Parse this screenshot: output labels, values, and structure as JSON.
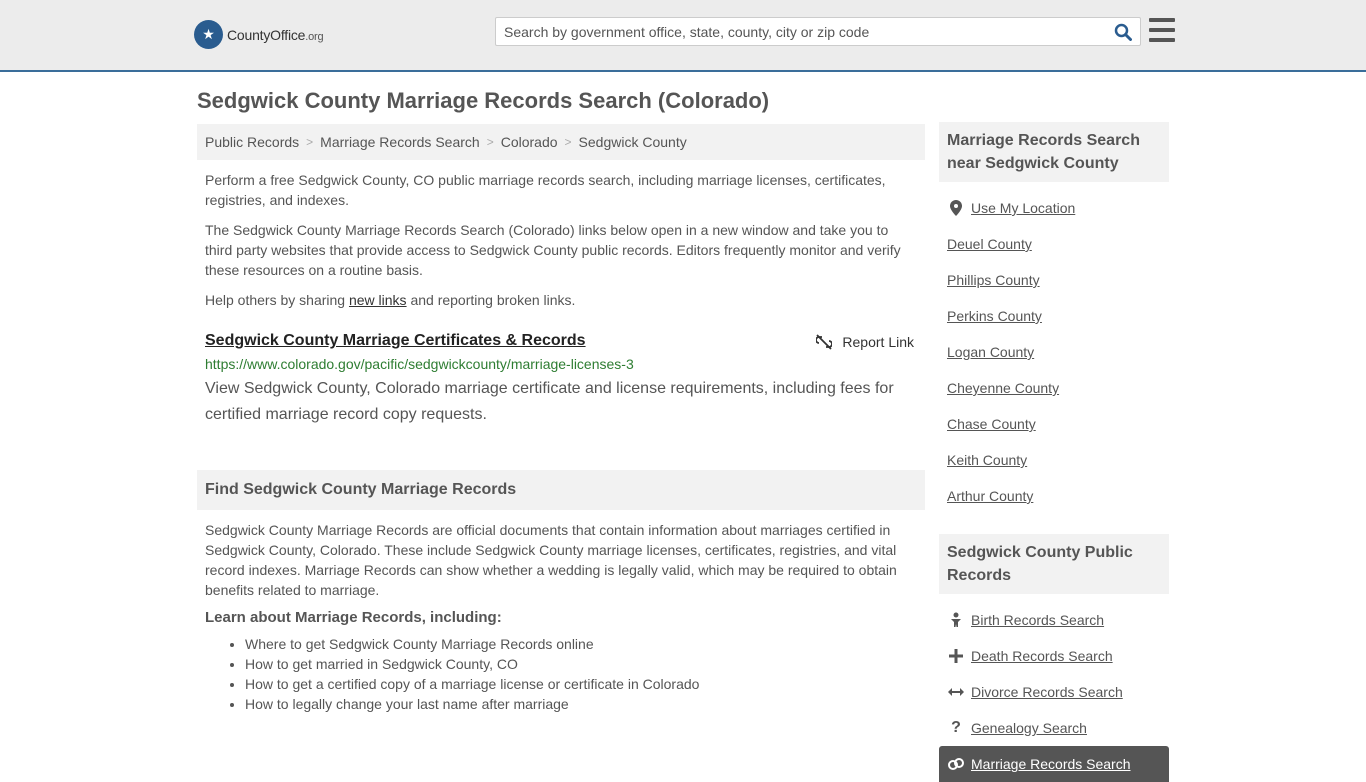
{
  "header": {
    "logo_text": "CountyOffice",
    "logo_tld": ".org",
    "search_placeholder": "Search by government office, state, county, city or zip code",
    "search_value": ""
  },
  "page_title": "Sedgwick County Marriage Records Search (Colorado)",
  "breadcrumb": [
    "Public Records",
    "Marriage Records Search",
    "Colorado",
    "Sedgwick County"
  ],
  "intro": {
    "p1": "Perform a free Sedgwick County, CO public marriage records search, including marriage licenses, certificates, registries, and indexes.",
    "p2": "The Sedgwick County Marriage Records Search (Colorado) links below open in a new window and take you to third party websites that provide access to Sedgwick County public records. Editors frequently monitor and verify these resources on a routine basis.",
    "p3_before": "Help others by sharing ",
    "p3_link": "new links",
    "p3_after": " and reporting broken links."
  },
  "result": {
    "title": "Sedgwick County Marriage Certificates & Records",
    "report_label": "Report Link",
    "url": "https://www.colorado.gov/pacific/sedgwickcounty/marriage-licenses-3",
    "description": "View Sedgwick County, Colorado marriage certificate and license requirements, including fees for certified marriage record copy requests."
  },
  "find_section": {
    "heading": "Find Sedgwick County Marriage Records",
    "body": "Sedgwick County Marriage Records are official documents that contain information about marriages certified in Sedgwick County, Colorado. These include Sedgwick County marriage licenses, certificates, registries, and vital record indexes. Marriage Records can show whether a wedding is legally valid, which may be required to obtain benefits related to marriage.",
    "learn_heading": "Learn about Marriage Records, including:",
    "learn_items": [
      "Where to get Sedgwick County Marriage Records online",
      "How to get married in Sedgwick County, CO",
      "How to get a certified copy of a marriage license or certificate in Colorado",
      "How to legally change your last name after marriage"
    ]
  },
  "sidebar": {
    "nearby_heading": "Marriage Records Search near Sedgwick County",
    "use_location": "Use My Location",
    "nearby": [
      "Deuel County",
      "Phillips County",
      "Perkins County",
      "Logan County",
      "Cheyenne County",
      "Chase County",
      "Keith County",
      "Arthur County"
    ],
    "public_heading": "Sedgwick County Public Records",
    "public_items": [
      {
        "label": "Birth Records Search",
        "icon": "baby-icon"
      },
      {
        "label": "Death Records Search",
        "icon": "cross-icon"
      },
      {
        "label": "Divorce Records Search",
        "icon": "arrows-icon"
      },
      {
        "label": "Genealogy Search",
        "icon": "question-icon"
      },
      {
        "label": "Marriage Records Search",
        "icon": "rings-icon"
      }
    ]
  }
}
